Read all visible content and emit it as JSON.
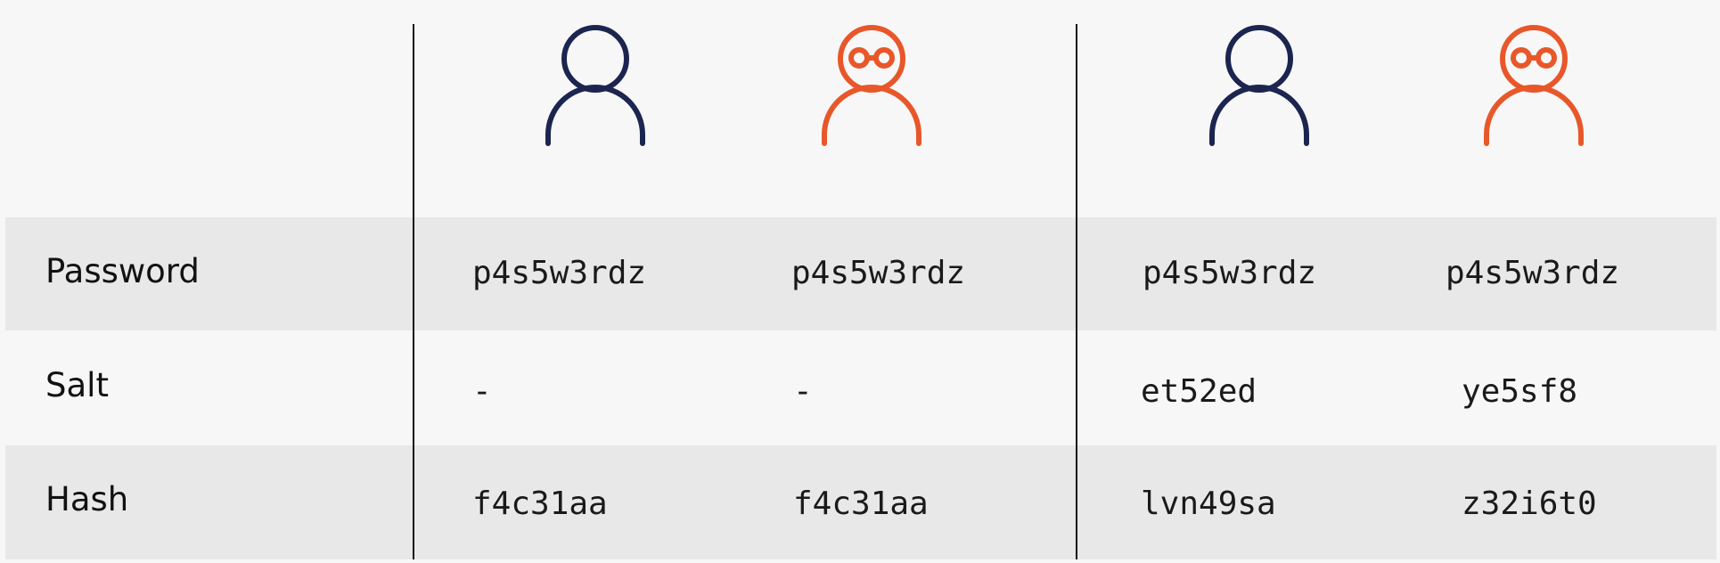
{
  "colors": {
    "user_icon": "#1b2550",
    "attacker_icon": "#e8572a",
    "row_band": "#e8e8e8",
    "background": "#f7f7f7",
    "divider": "#111111"
  },
  "columns": [
    {
      "icon": "person-icon",
      "icon_color": "#1b2550"
    },
    {
      "icon": "person-with-glasses-icon",
      "icon_color": "#e8572a"
    },
    {
      "icon": "person-icon",
      "icon_color": "#1b2550"
    },
    {
      "icon": "person-with-glasses-icon",
      "icon_color": "#e8572a"
    }
  ],
  "rows": {
    "password": {
      "label": "Password",
      "values": [
        "p4s5w3rdz",
        "p4s5w3rdz",
        "p4s5w3rdz",
        "p4s5w3rdz"
      ]
    },
    "salt": {
      "label": "Salt",
      "values": [
        "-",
        "-",
        "et52ed",
        "ye5sf8"
      ]
    },
    "hash": {
      "label": "Hash",
      "values": [
        "f4c31aa",
        "f4c31aa",
        "lvn49sa",
        "z32i6t0"
      ]
    }
  }
}
